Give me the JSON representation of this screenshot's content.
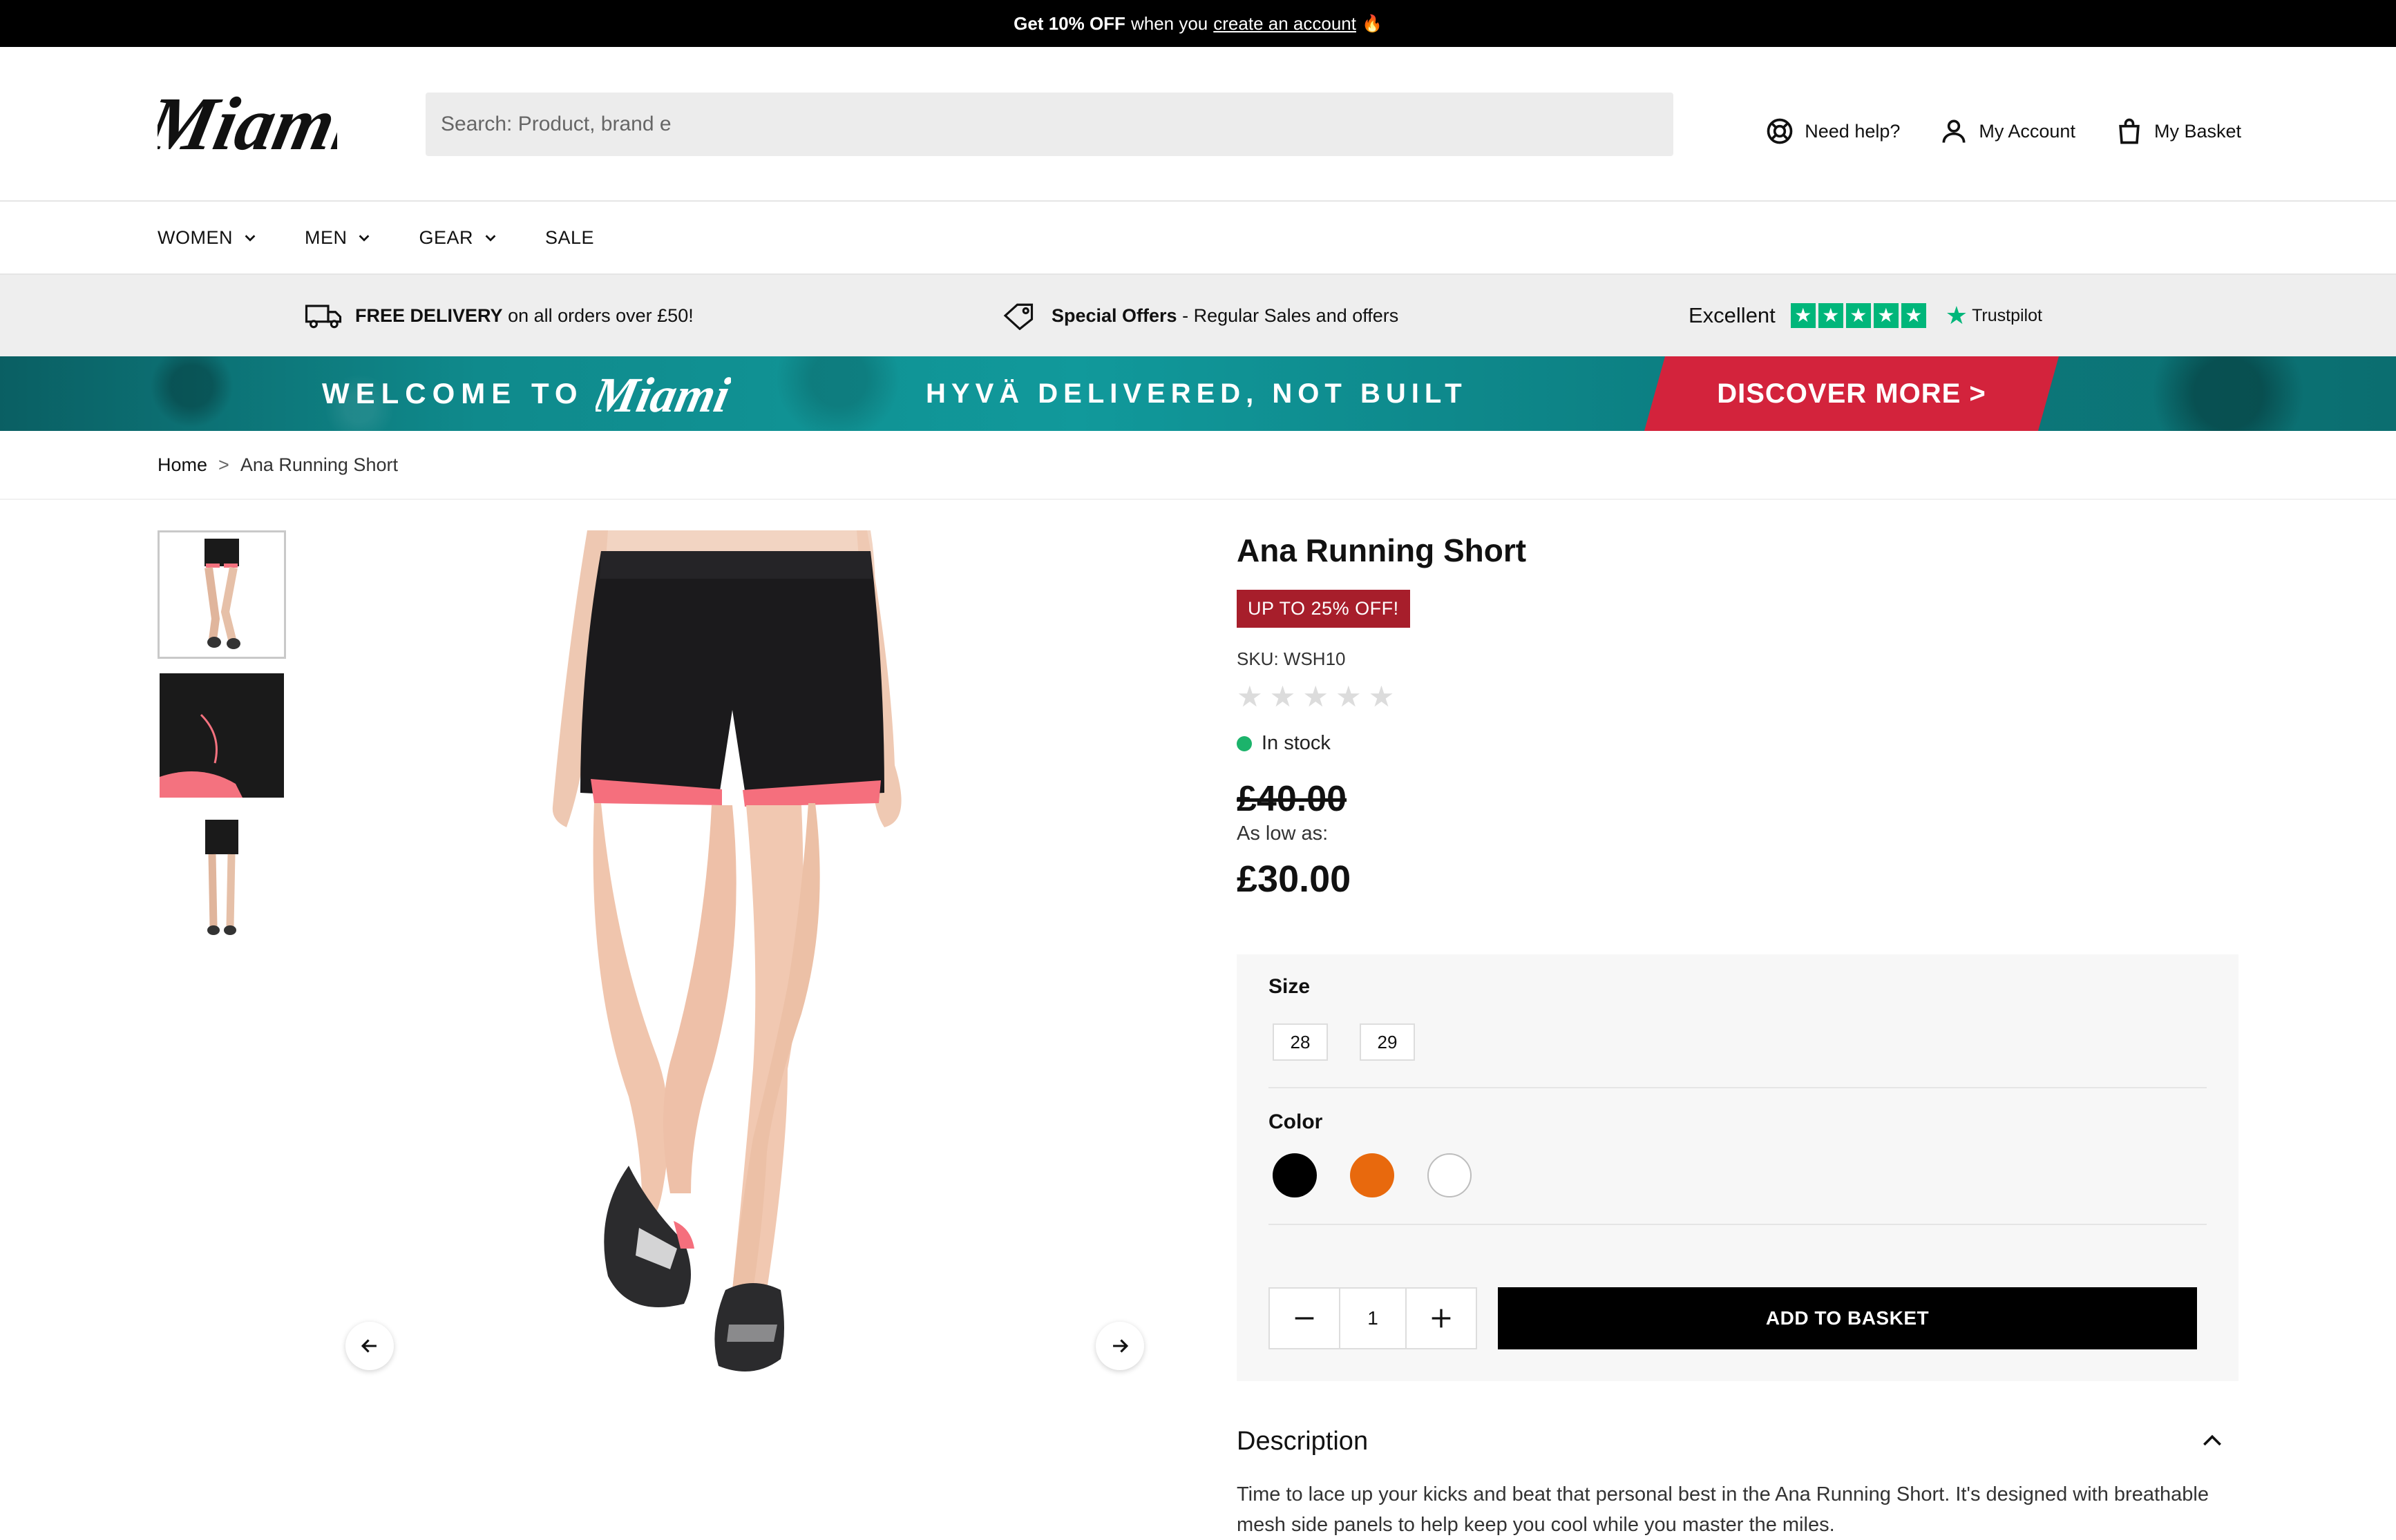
{
  "promo": {
    "bold": "Get 10% OFF",
    "text": "when you",
    "link": "create an account",
    "icon": "flame-icon"
  },
  "header": {
    "logo_text": "Miami",
    "search_placeholder": "Search: Product, brand e",
    "links": [
      {
        "label": "Need help?",
        "icon": "lifebuoy-icon"
      },
      {
        "label": "My Account",
        "icon": "user-icon"
      },
      {
        "label": "My Basket",
        "icon": "bag-icon"
      }
    ]
  },
  "nav": {
    "items": [
      {
        "label": "WOMEN",
        "has_dropdown": true
      },
      {
        "label": "MEN",
        "has_dropdown": true
      },
      {
        "label": "GEAR",
        "has_dropdown": true
      },
      {
        "label": "SALE",
        "has_dropdown": false
      }
    ]
  },
  "usp": {
    "delivery_bold": "FREE DELIVERY",
    "delivery_text": "on all orders over £50!",
    "offers_bold": "Special Offers",
    "offers_text": "- Regular Sales and offers",
    "rating_label": "Excellent",
    "trustpilot": "Trustpilot",
    "trustpilot_color": "#00b67a"
  },
  "banner": {
    "welcome": "WELCOME TO",
    "logo_text": "Miami",
    "tagline": "HYVÄ DELIVERED, NOT BUILT",
    "cta": "DISCOVER MORE >",
    "cta_color": "#d3233c"
  },
  "breadcrumb": {
    "home": "Home",
    "separator": ">",
    "current": "Ana Running Short"
  },
  "product": {
    "title": "Ana Running Short",
    "badge": "UP TO 25% OFF!",
    "badge_color": "#a71e2b",
    "sku": "SKU: WSH10",
    "rating": 0,
    "rating_max": 5,
    "stock": "In stock",
    "stock_color": "#1cb36b",
    "old_price": "£40.00",
    "as_low_as": "As low as:",
    "price": "£30.00",
    "thumbnails": [
      "thumb-front",
      "thumb-detail",
      "thumb-full"
    ]
  },
  "options": {
    "size_label": "Size",
    "sizes": [
      "28",
      "29"
    ],
    "color_label": "Color",
    "colors": [
      {
        "name": "Black",
        "hex": "#000000"
      },
      {
        "name": "Orange",
        "hex": "#e8690d"
      },
      {
        "name": "White",
        "hex": "#ffffff"
      }
    ],
    "quantity": "1",
    "add_to_basket": "ADD TO BASKET"
  },
  "description": {
    "heading": "Description",
    "text": "Time to lace up your kicks and beat that personal best in the Ana Running Short. It's designed with breathable mesh side panels to help keep you cool while you master the miles."
  }
}
